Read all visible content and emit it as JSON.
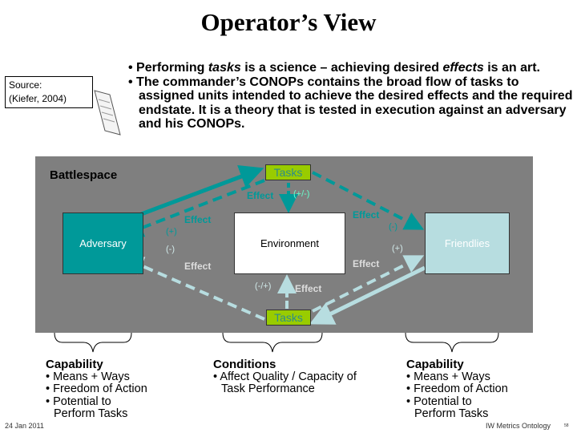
{
  "title": "Operator’s View",
  "source": {
    "line1": "Source:",
    "line2": "(Kiefer, 2004)"
  },
  "bullets": [
    {
      "pre": "• Performing ",
      "em1": "tasks",
      "mid": " is a science – achieving desired ",
      "em2": "effects",
      "post": " is an art."
    },
    {
      "text": "• The commander’s CONOPs contains the broad flow of tasks to assigned units intended to achieve the desired effects and the required endstate.  It is a theory that is tested in execution against an adversary and his CONOPs."
    }
  ],
  "diagram": {
    "heading": "Battlespace",
    "tasks_top": "Tasks",
    "tasks_bottom": "Tasks",
    "adversary": "Adversary",
    "environment": "Environment",
    "friendlies": "Friendlies",
    "effect": "Effect",
    "pm": "(+/-)",
    "mp": "(-/+)",
    "plus": "(+)",
    "minus": "(-)",
    "colors": {
      "teal": "#009999",
      "light": "#b7dde0",
      "task_fill": "#99cc00",
      "background": "#7f7f7f"
    }
  },
  "columns": [
    {
      "heading": "Capability",
      "items": [
        "Means + Ways",
        "Freedom of Action",
        "Potential to Perform Tasks"
      ]
    },
    {
      "heading": "Conditions",
      "items": [
        "Affect Quality / Capacity of Task Performance"
      ]
    },
    {
      "heading": "Capability",
      "items": [
        "Means + Ways",
        "Freedom of Action",
        "Potential to Perform Tasks"
      ]
    }
  ],
  "footer": {
    "date": "24 Jan 2011",
    "org": "IW Metrics Ontology",
    "page": "58"
  }
}
